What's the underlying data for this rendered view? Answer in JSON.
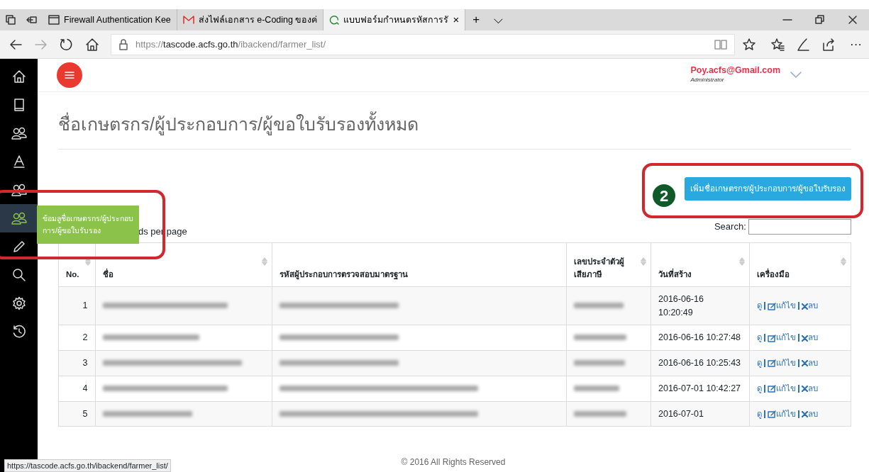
{
  "browser": {
    "tabs": [
      {
        "label": "Firewall Authentication Kee",
        "kind": "page",
        "selected": false
      },
      {
        "label": "ส่งไฟล์เอกสาร e-Coding ของค่",
        "kind": "mail",
        "selected": false
      },
      {
        "label": "แบบฟอร์มกำหนดรหัสการรั",
        "kind": "site",
        "selected": true
      }
    ],
    "close_tab": "×",
    "new_tab": "+",
    "tab_menu": "⌵",
    "url": {
      "scheme": "https://",
      "host": "tascode.acfs.go.th",
      "path": "/ibackend/farmer_list/"
    },
    "more": "···",
    "status_url": "https://tascode.acfs.go.th/ibackend/farmer_list/"
  },
  "sidebar": {
    "items": [
      {
        "selected": false
      },
      {
        "selected": false
      },
      {
        "selected": false
      },
      {
        "selected": false
      },
      {
        "selected": false
      },
      {
        "selected": true
      },
      {
        "selected": false
      },
      {
        "selected": false
      },
      {
        "selected": false
      },
      {
        "selected": false
      }
    ],
    "tooltip": "ข้อมลูชื่อเกษตรกร/ผู้ประกอบการ/ผู้ขอใบรับรอง"
  },
  "user": {
    "email": "Poy.acfs@Gmail.com",
    "role": "Administrator"
  },
  "page_title": "ชื่อเกษตรกร/ผู้ประกอบการ/ผู้ขอใบรับรองทั้งหมด",
  "annotation": {
    "number": "2"
  },
  "add_button": "เพิ่มชื่อเกษตรกร/ผู้ประกอบการ/ผู้ขอใบรับรอง",
  "length_label": "ds per page",
  "search_label": "Search:",
  "table": {
    "columns": [
      {
        "label": "No.",
        "sortable": true
      },
      {
        "label": "ชื่อ",
        "sortable": true
      },
      {
        "label": "รหัสผู้ประกอบการตรวจสอบมาตรฐาน",
        "sortable": false
      },
      {
        "label": "เลขประจำตัวผู้เสียภาษี",
        "sortable": true
      },
      {
        "label": "วันที่สร้าง",
        "sortable": true
      },
      {
        "label": "เครื่องมือ",
        "sortable": true
      }
    ],
    "rows": [
      {
        "no": "1",
        "created": "2016-06-16\n10:20:49",
        "actions": [
          {
            "kind": "view",
            "label": "ดู"
          },
          {
            "kind": "edit",
            "label": "แก้ไข"
          },
          {
            "kind": "delete",
            "label": "ลบ"
          }
        ]
      },
      {
        "no": "2",
        "created": "2016-06-16 10:27:48",
        "actions": [
          {
            "kind": "view",
            "label": "ดู"
          },
          {
            "kind": "edit",
            "label": "แก้ไข"
          },
          {
            "kind": "delete",
            "label": "ลบ"
          }
        ]
      },
      {
        "no": "3",
        "created": "2016-06-16 10:25:43",
        "actions": [
          {
            "kind": "view",
            "label": "ดู"
          },
          {
            "kind": "edit",
            "label": "แก้ไข"
          },
          {
            "kind": "delete",
            "label": "ลบ"
          }
        ]
      },
      {
        "no": "4",
        "created": "2016-07-01 10:42:27",
        "actions": [
          {
            "kind": "view",
            "label": "ดู"
          },
          {
            "kind": "edit",
            "label": "แก้ไข"
          },
          {
            "kind": "delete",
            "label": "ลบ"
          }
        ]
      },
      {
        "no": "5",
        "created": "2016-07-01",
        "actions": [
          {
            "kind": "view",
            "label": "ดู"
          },
          {
            "kind": "edit",
            "label": "แก้ไข"
          },
          {
            "kind": "delete",
            "label": "ลบ"
          }
        ]
      }
    ]
  },
  "footer": "© 2016 All Rights Reserved"
}
